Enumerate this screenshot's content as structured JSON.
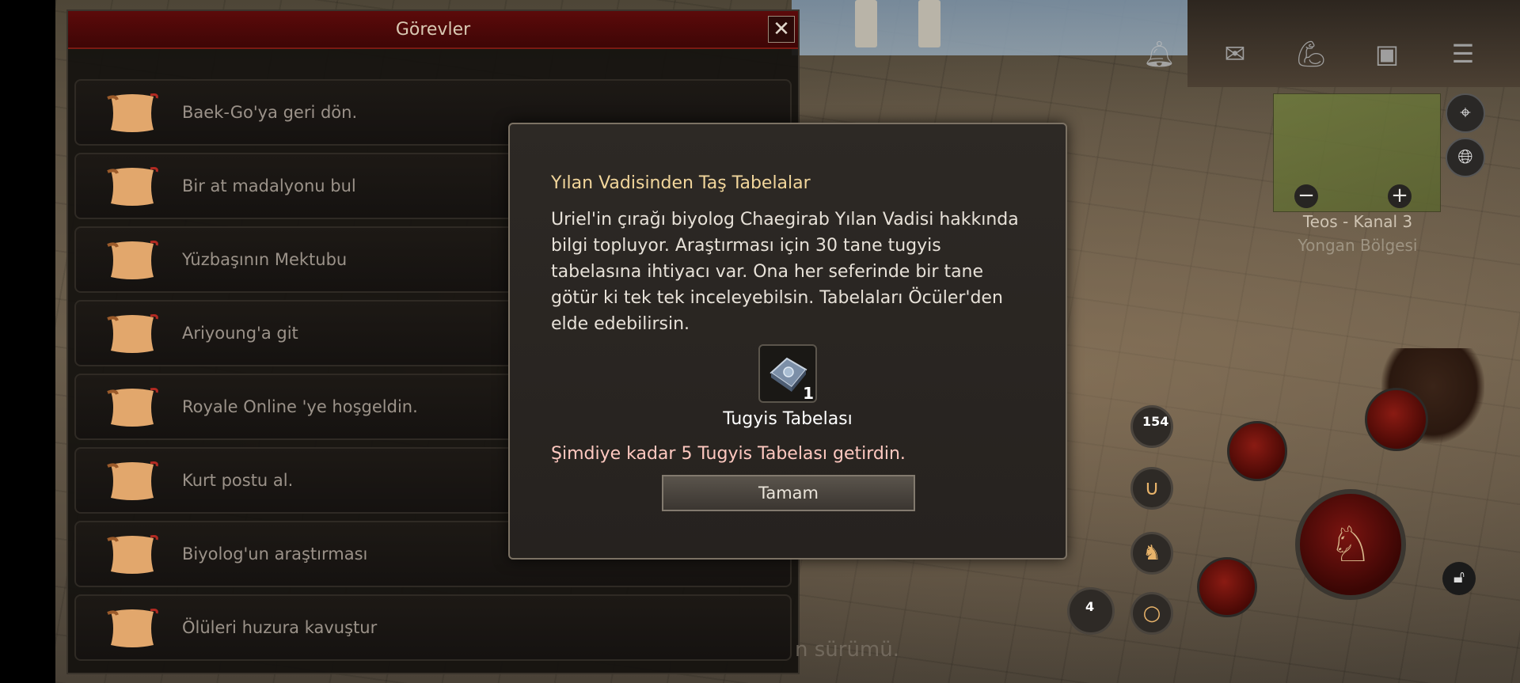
{
  "quest_panel": {
    "title": "Görevler",
    "close_glyph": "✕",
    "items": [
      {
        "label": "Baek-Go'ya geri dön."
      },
      {
        "label": "Bir at madalyonu bul"
      },
      {
        "label": "Yüzbaşının Mektubu"
      },
      {
        "label": "Ariyoung'a git"
      },
      {
        "label": "Royale Online 'ye hoşgeldin."
      },
      {
        "label": "Kurt postu al."
      },
      {
        "label": "Biyolog'un araştırması"
      },
      {
        "label": "Ölüleri huzura kavuştur"
      }
    ]
  },
  "dialog": {
    "title": "Yılan Vadisinden Taş Tabelalar",
    "description": "Uriel'in çırağı biyolog Chaegirab Yılan Vadisi hakkında bilgi topluyor. Araştırması için 30 tane tugyis tabelasına ihtiyacı var. Ona her seferinde bir tane götür ki tek tek inceleyebilsin. Tabelaları Öcüler'den elde edebilirsin.",
    "reward": {
      "name": "Tugyis Tabelası",
      "count": "1"
    },
    "progress": "Şimdiye kadar 5 Tugyis Tabelası getirdin.",
    "ok_label": "Tamam"
  },
  "minimap": {
    "channel": "Teos - Kanal 3",
    "region": "Yongan Bölgesi",
    "zoom_out": "−",
    "zoom_in": "+"
  },
  "hud": {
    "skill_count_1": "154",
    "skill_count_2": "4",
    "ghost_text": "n sürümü."
  },
  "icons": [
    "bell-icon",
    "mail-icon",
    "strength-icon",
    "bag-icon",
    "menu-icon",
    "map-pin-icon",
    "globe-icon",
    "horseshoe-icon",
    "mount-icon",
    "lock-icon",
    "scroll-icon"
  ],
  "colors": {
    "title_bar": "#5c0a0a",
    "dialog_title": "#f2d69b",
    "progress_text": "#ffc9c0",
    "quest_text": "#9b9289"
  }
}
